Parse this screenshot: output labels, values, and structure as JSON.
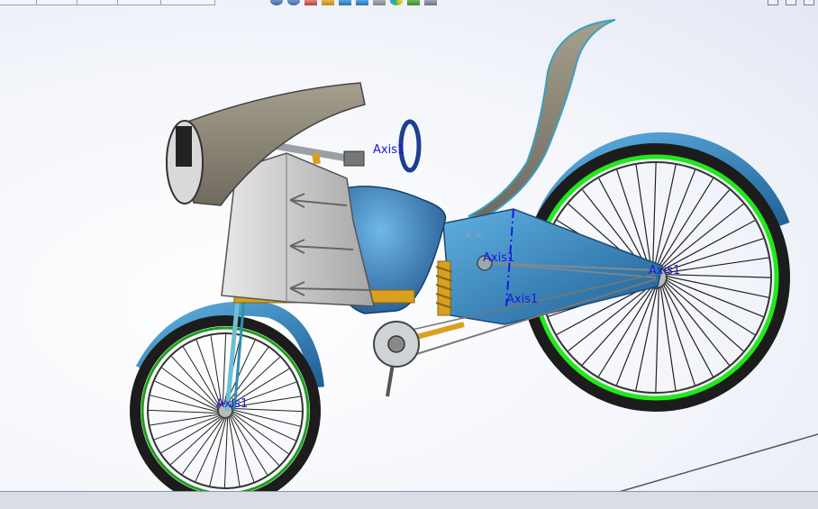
{
  "viewport": {
    "axis_labels": {
      "front_wheel": "Axis1",
      "steering": "Axis1",
      "swingarm_pivot": "Axis1",
      "rear_hub": "Axis1",
      "swingarm_lower": "Axis1"
    }
  },
  "colors": {
    "body_blue": "#2e7fb8",
    "fairing_grey": "#c9c9c9",
    "seat_tan": "#8d8675",
    "tire_ring": "#22e81a",
    "axis_label": "#1a1ad8",
    "spring": "#d9a020"
  },
  "toolbar": {
    "icons": [
      "zoom-to-fit-icon",
      "zoom-area-icon",
      "previous-view-icon",
      "section-view-icon",
      "view-orientation-icon",
      "display-style-icon",
      "hide-show-icon",
      "edit-appearance-icon",
      "apply-scene-icon",
      "view-settings-icon"
    ]
  }
}
